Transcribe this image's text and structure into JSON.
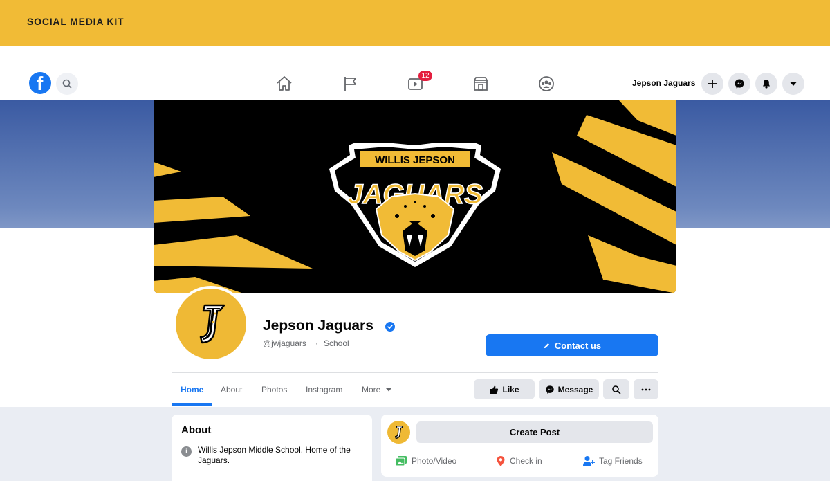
{
  "banner": {
    "title": "SOCIAL MEDIA KIT"
  },
  "nav": {
    "search_icon": "search-icon",
    "tabs": [
      "home-icon",
      "flag-icon",
      "watch-icon",
      "marketplace-icon",
      "groups-icon"
    ],
    "watch_badge": "12",
    "username": "Jepson Jaguars",
    "right_buttons": [
      "plus-icon",
      "messenger-icon",
      "bell-icon",
      "caret-down-icon"
    ]
  },
  "cover": {
    "school_line": "WILLIS JEPSON",
    "team_name": "JAGUARS",
    "colors": {
      "gold": "#f1bb36",
      "black": "#000000"
    }
  },
  "profile": {
    "name": "Jepson Jaguars",
    "handle": "@jwjaguars",
    "separator": "·",
    "category": "School",
    "contact_label": "Contact us",
    "avatar_letter": "J"
  },
  "tabs": [
    "Home",
    "About",
    "Photos",
    "Instagram",
    "More"
  ],
  "actions": {
    "like": "Like",
    "message": "Message"
  },
  "about": {
    "title": "About",
    "text": "Willis Jepson Middle School. Home of the Jaguars."
  },
  "composer": {
    "create_post": "Create Post",
    "photo_video": "Photo/Video",
    "check_in": "Check in",
    "tag_friends": "Tag Friends"
  },
  "colors": {
    "accent": "#1877f2",
    "brand_gold": "#f1bb36",
    "badge": "#e41e3f"
  }
}
